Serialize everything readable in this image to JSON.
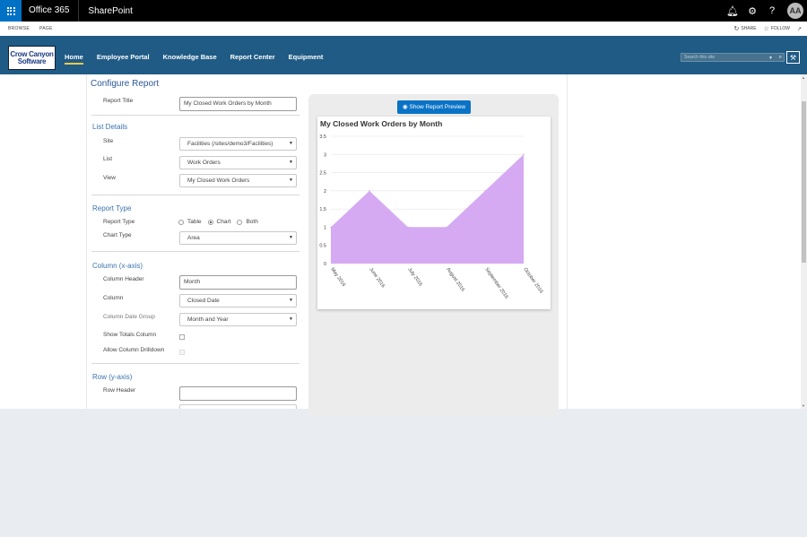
{
  "suitebar": {
    "brand": "Office 365",
    "app": "SharePoint",
    "avatar_initials": "AA"
  },
  "ribbon": {
    "tabs": [
      "BROWSE",
      "PAGE"
    ],
    "share": "SHARE",
    "follow": "FOLLOW"
  },
  "logo": {
    "line1": "Crow Canyon",
    "line2": "Software"
  },
  "topnav": [
    "Home",
    "Employee Portal",
    "Knowledge Base",
    "Report Center",
    "Equipment"
  ],
  "search": {
    "placeholder": "Search this site"
  },
  "form": {
    "page_title": "Configure Report",
    "report_title_label": "Report Title",
    "report_title_value": "My Closed Work Orders by Month",
    "list_details": {
      "title": "List Details",
      "site_label": "Site",
      "site_value": "Facilities (/sites/demo3/Facilities)",
      "list_label": "List",
      "list_value": "Work Orders",
      "view_label": "View",
      "view_value": "My Closed Work Orders"
    },
    "report_type": {
      "title": "Report Type",
      "type_label": "Report Type",
      "options": [
        "Table",
        "Chart",
        "Both"
      ],
      "selected": "Chart",
      "chart_type_label": "Chart Type",
      "chart_type_value": "Area"
    },
    "column": {
      "title": "Column (x-axis)",
      "header_label": "Column Header",
      "header_value": "Month",
      "column_label": "Column",
      "column_value": "Closed Date",
      "date_group_label": "Column Date Group",
      "date_group_value": "Month and Year",
      "totals_label": "Show Totals Column",
      "drilldown_label": "Allow Column Drilldown"
    },
    "row": {
      "title": "Row (y-axis)",
      "header_label": "Row Header",
      "header_value": ""
    }
  },
  "preview": {
    "button_label": "Show Report Preview",
    "accent": "#0a73c6"
  },
  "chart_data": {
    "type": "area",
    "title": "My Closed Work Orders by Month",
    "categories": [
      "May 2016",
      "June 2016",
      "July 2016",
      "August 2016",
      "September 2016",
      "October 2016"
    ],
    "values": [
      1,
      2,
      1,
      1,
      2,
      3
    ],
    "ylim": [
      0,
      3.5
    ],
    "yticks": [
      "0",
      "0.5",
      "1",
      "1.5",
      "2",
      "2.5",
      "3",
      "3.5"
    ],
    "grid": true,
    "fill": "#d5aaf2"
  }
}
